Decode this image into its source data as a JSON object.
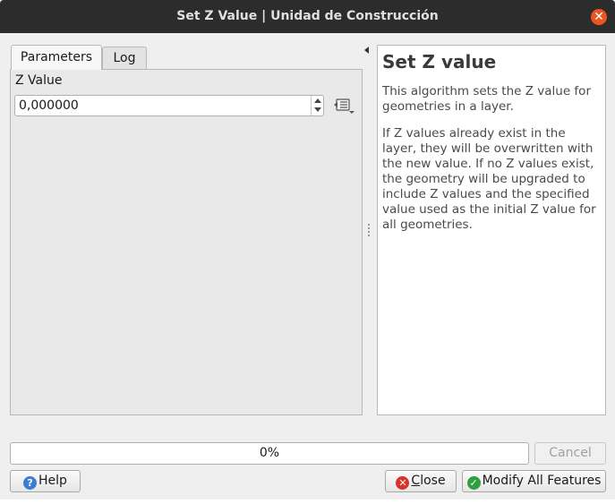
{
  "window": {
    "title": "Set Z Value | Unidad de Construcción",
    "close_glyph": "✕"
  },
  "tabs": [
    {
      "label": "Parameters",
      "active": true
    },
    {
      "label": "Log",
      "active": false
    }
  ],
  "parameters": {
    "z_value_label": "Z Value",
    "z_value": "0,000000"
  },
  "help": {
    "title": "Set Z value",
    "paragraphs": [
      "This algorithm sets the Z value for geometries in a layer.",
      "If Z values already exist in the layer, they will be overwritten with the new value. If no Z values exist, the geometry will be upgraded to include Z values and the specified value used as the initial Z value for all geometries."
    ]
  },
  "progress": {
    "text": "0%",
    "value": 0
  },
  "buttons": {
    "cancel": "Cancel",
    "help": "Help",
    "close_prefix": "",
    "close_underlined": "C",
    "close_rest": "lose",
    "modify": "Modify All Features"
  },
  "icons": {
    "help": "help-icon",
    "close": "close-circle-icon",
    "modify": "check-circle-icon",
    "override": "data-defined-override-icon"
  },
  "colors": {
    "titlebar": "#2c2c2c",
    "accent": "#e95420"
  }
}
